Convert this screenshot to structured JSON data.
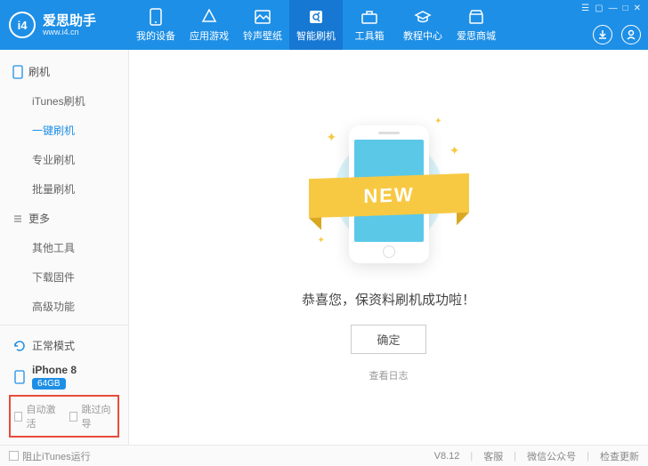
{
  "brand": {
    "name": "爱思助手",
    "url": "www.i4.cn"
  },
  "nav": [
    {
      "label": "我的设备"
    },
    {
      "label": "应用游戏"
    },
    {
      "label": "铃声壁纸"
    },
    {
      "label": "智能刷机"
    },
    {
      "label": "工具箱"
    },
    {
      "label": "教程中心"
    },
    {
      "label": "爱思商城"
    }
  ],
  "sidebar": {
    "group1": {
      "title": "刷机",
      "items": [
        "iTunes刷机",
        "一键刷机",
        "专业刷机",
        "批量刷机"
      ]
    },
    "group2": {
      "title": "更多",
      "items": [
        "其他工具",
        "下载固件",
        "高级功能"
      ]
    },
    "mode": "正常模式",
    "device": {
      "name": "iPhone 8",
      "storage": "64GB"
    },
    "checks": {
      "autoActivate": "自动激活",
      "skipGuide": "跳过向导"
    }
  },
  "content": {
    "ribbon": "NEW",
    "successText": "恭喜您，保资料刷机成功啦！",
    "okButton": "确定",
    "logLink": "查看日志"
  },
  "footer": {
    "blockItunes": "阻止iTunes运行",
    "version": "V8.12",
    "support": "客服",
    "wechat": "微信公众号",
    "checkUpdate": "检查更新"
  }
}
